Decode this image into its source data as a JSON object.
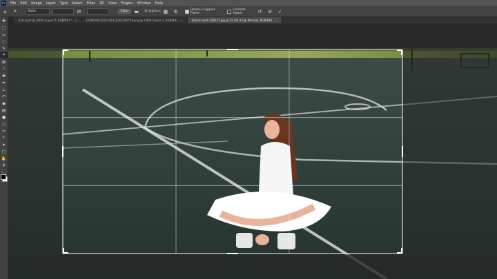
{
  "menubar": {
    "logo": "Ps",
    "items": [
      "File",
      "Edit",
      "Image",
      "Layer",
      "Type",
      "Select",
      "Filter",
      "3D",
      "View",
      "Plugins",
      "Window",
      "Help"
    ]
  },
  "options": {
    "ratio": "Ratio",
    "clear": "Clear",
    "straighten": "Straighten",
    "delete_cropped": "Delete Cropped Pixels",
    "content_aware": "Content-Aware"
  },
  "tabs": [
    {
      "label": "가나다.psd @ 100% (Layer 0, RGB/8#) *",
      "active": false
    },
    {
      "label": "GOMCAM 20221024_2145590754.png @ 100% (Layer 1, RGB/8#)",
      "active": false
    },
    {
      "label": "tennis-court-238137.jpg @ 33.3% (Crop Preview, RGB/8#)",
      "active": true
    }
  ]
}
